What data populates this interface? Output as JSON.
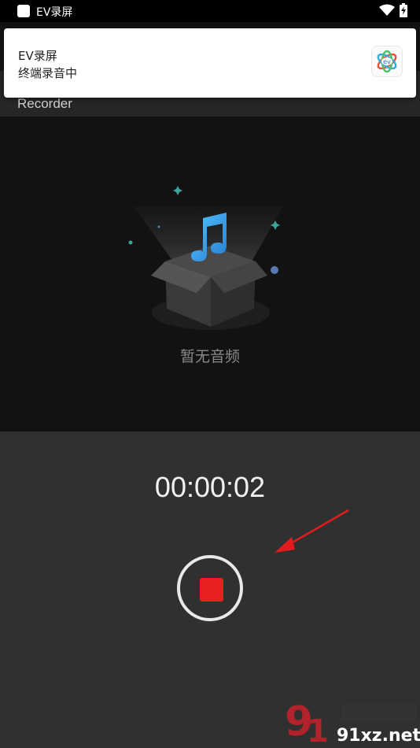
{
  "status_bar": {
    "app_title": "EV录屏"
  },
  "notification": {
    "app_name": "EV录屏",
    "message": "终端录音中",
    "icon": "ev-logo-icon"
  },
  "toolbar": {
    "title": "Recorder"
  },
  "empty_state": {
    "text": "暂无音频",
    "icon": "music-box-icon"
  },
  "recorder": {
    "timer": "00:00:02",
    "stop_icon": "stop-icon"
  },
  "watermark": {
    "text": "91xz.net"
  },
  "colors": {
    "accent_red": "#e8201f",
    "panel": "#303030",
    "background": "#121212",
    "note_blue": "#3aa6e8"
  }
}
